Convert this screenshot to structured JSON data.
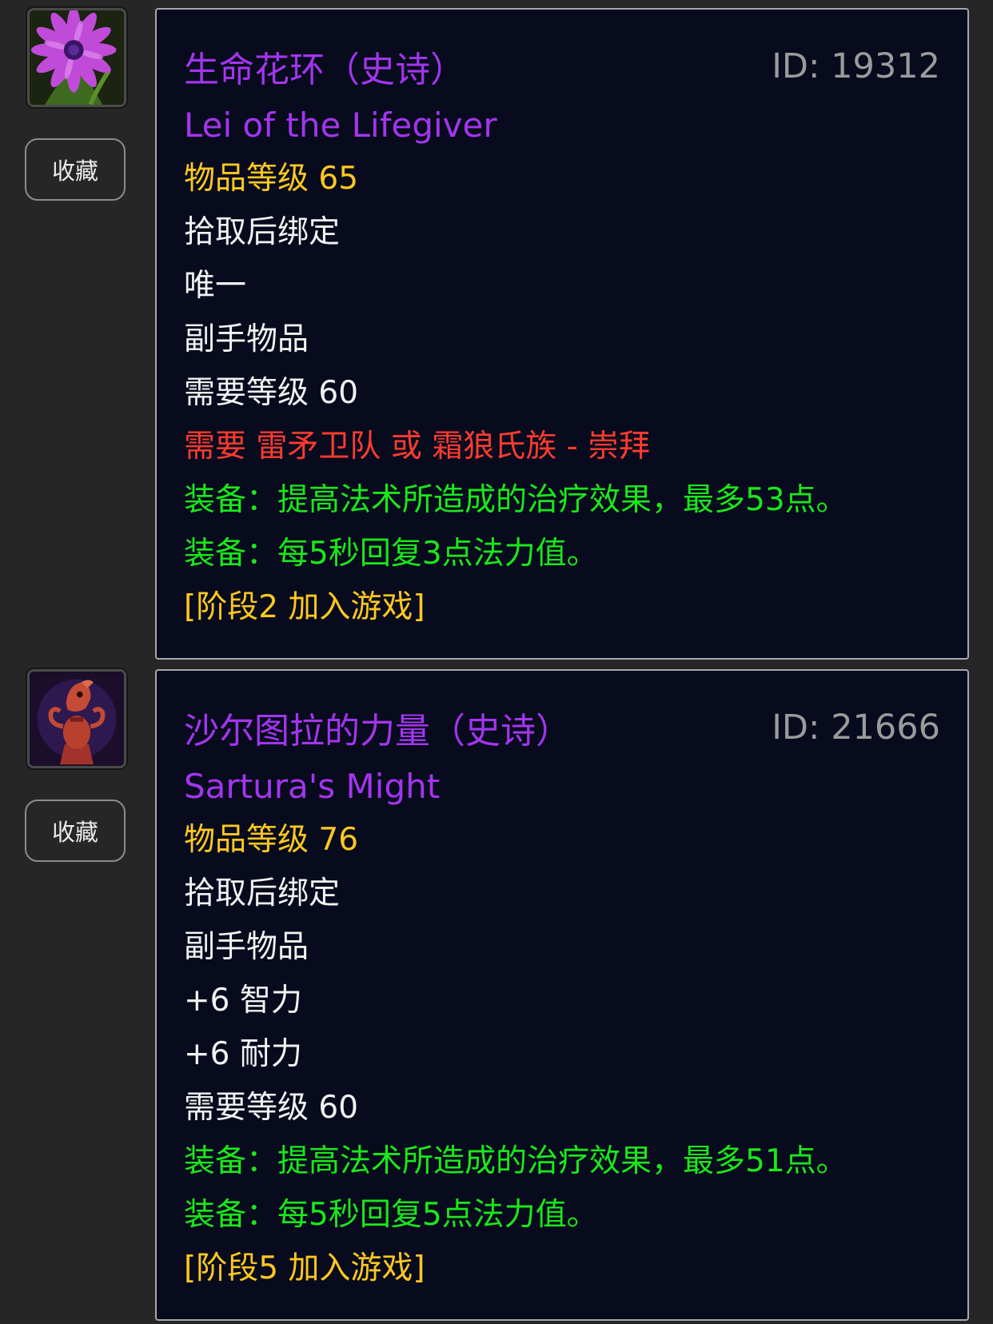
{
  "fav_label": "收藏",
  "colors": {
    "background": "#262626",
    "tooltip_bg": "#070b1d",
    "epic_purple": "#a335ee",
    "gold": "#ffc820",
    "requirement_red": "#ff3b30",
    "equip_green": "#1ae81a",
    "id_gray": "#9b9b9b"
  },
  "items": [
    {
      "icon": "purple-flower-icon",
      "title_cn": "生命花环（史诗）",
      "title_en": "Lei of the Lifegiver",
      "id_text": "ID: 19312",
      "lines": [
        {
          "text": "物品等级 65",
          "color": "gold"
        },
        {
          "text": "拾取后绑定",
          "color": "white"
        },
        {
          "text": "唯一",
          "color": "white"
        },
        {
          "text": "副手物品",
          "color": "white"
        },
        {
          "text": "需要等级 60",
          "color": "white"
        },
        {
          "text": "需要 雷矛卫队 或 霜狼氏族 - 崇拜",
          "color": "red"
        },
        {
          "text": "装备：提高法术所造成的治疗效果，最多53点。",
          "color": "green"
        },
        {
          "text": "装备：每5秒回复3点法力值。",
          "color": "green"
        },
        {
          "text": "[阶段2 加入游戏]",
          "color": "gold"
        }
      ]
    },
    {
      "icon": "red-idol-icon",
      "title_cn": "沙尔图拉的力量（史诗）",
      "title_en": "Sartura's Might",
      "id_text": "ID: 21666",
      "lines": [
        {
          "text": "物品等级 76",
          "color": "gold"
        },
        {
          "text": "拾取后绑定",
          "color": "white"
        },
        {
          "text": "副手物品",
          "color": "white"
        },
        {
          "text": "+6 智力",
          "color": "white"
        },
        {
          "text": "+6 耐力",
          "color": "white"
        },
        {
          "text": "需要等级 60",
          "color": "white"
        },
        {
          "text": "装备：提高法术所造成的治疗效果，最多51点。",
          "color": "green"
        },
        {
          "text": "装备：每5秒回复5点法力值。",
          "color": "green"
        },
        {
          "text": "[阶段5 加入游戏]",
          "color": "gold"
        }
      ]
    }
  ]
}
